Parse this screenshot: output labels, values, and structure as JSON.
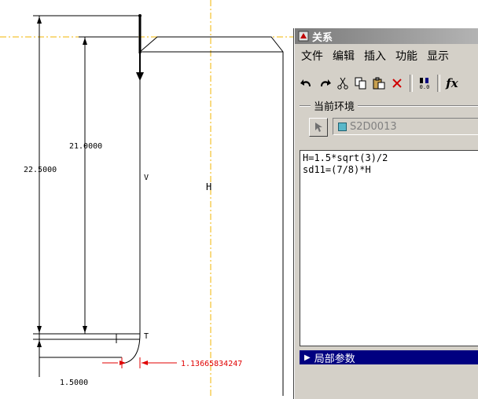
{
  "sketch": {
    "dims": {
      "d1": "22.5000",
      "d2": "21.0000",
      "d3": "1.5000",
      "d4": "1.13665834247"
    },
    "marks": {
      "v": "V",
      "h": "H",
      "t": "T"
    }
  },
  "dialog": {
    "title": "关系",
    "menu": [
      "文件",
      "编辑",
      "插入",
      "功能",
      "显示"
    ],
    "toolbar": {
      "undo_icon": "undo-icon",
      "redo_icon": "redo-icon",
      "cut_icon": "scissors-icon",
      "copy_icon": "copy-icon",
      "paste_icon": "paste-icon",
      "delete_icon": "delete-x-icon",
      "number_label": "0.0",
      "fx_label": "fx"
    },
    "env_label": "当前环境",
    "env_value": "S2D0013",
    "relations": [
      "H=1.5*sqrt(3)/2",
      "sd11=(7/8)*H"
    ],
    "local_params": "局部参数"
  },
  "colors": {
    "centerline": "#f0b400",
    "dim_red": "#e00000",
    "title_gray": "#8a8a8a",
    "section_navy": "#000080"
  }
}
